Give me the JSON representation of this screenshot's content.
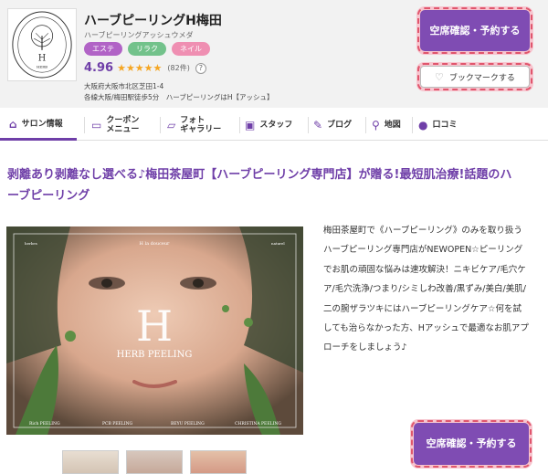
{
  "header": {
    "salon_name": "ハーブピーリングH梅田",
    "salon_kana": "ハーブピーリングアッシュウメダ",
    "tags": [
      "エステ",
      "リラク",
      "ネイル"
    ],
    "rating": "4.96",
    "stars": "★★★★★",
    "review_count": "(82件)",
    "help_icon": "?",
    "address": "大阪府大阪市北区芝田1-4",
    "access": "各線大阪/梅田駅徒歩5分　ハーブピーリングはH【アッシュ】",
    "reserve_label": "空席確認・予約する",
    "bookmark_label": "ブックマークする"
  },
  "logo": {
    "brand_text": "H",
    "brand_sub": "HERB",
    "ring_text": "H la douceur"
  },
  "nav": {
    "items": [
      {
        "label": "サロン情報",
        "icon": "house-icon"
      },
      {
        "label": "クーポン\nメニュー",
        "icon": "coupon-icon"
      },
      {
        "label": "フォト\nギャラリー",
        "icon": "photo-icon"
      },
      {
        "label": "スタッフ",
        "icon": "staff-icon"
      },
      {
        "label": "ブログ",
        "icon": "pen-icon"
      },
      {
        "label": "地図",
        "icon": "map-pin-icon"
      },
      {
        "label": "口コミ",
        "icon": "speech-bubble-icon"
      }
    ]
  },
  "catch_copy": "剥離あり剥離なし選べる♪梅田茶屋町【ハーブピーリング専門店】が贈る!最短肌治療!話題のハーブピーリング",
  "photo": {
    "big_letter": "H",
    "caption": "HERB PEELING",
    "top_center": "H la douceur",
    "top_left": "herbes",
    "top_right": "naturel",
    "bottom_labels": [
      "Rich PEELING",
      "PCB PEELING",
      "BEYU PEELING",
      "CHRISTINA PEELING"
    ]
  },
  "description": "梅田茶屋町で《ハーブピーリング》のみを取り扱うハーブピーリング専門店がNEWOPEN☆ピーリングでお肌の頑固な悩みは速攻解決！ニキビケア/毛穴ケア/毛穴洗浄/つまり/シミしわ改善/黒ずみ/美白/美肌/二の腕ザラツキにはハーブピーリングケア☆何を試しても治らなかった方、Hアッシュで最適なお肌アプローチをしましょう♪",
  "colors": {
    "brand_purple": "#7f4cb3",
    "header_bg": "#f2f2f2",
    "star": "#f5a623"
  }
}
